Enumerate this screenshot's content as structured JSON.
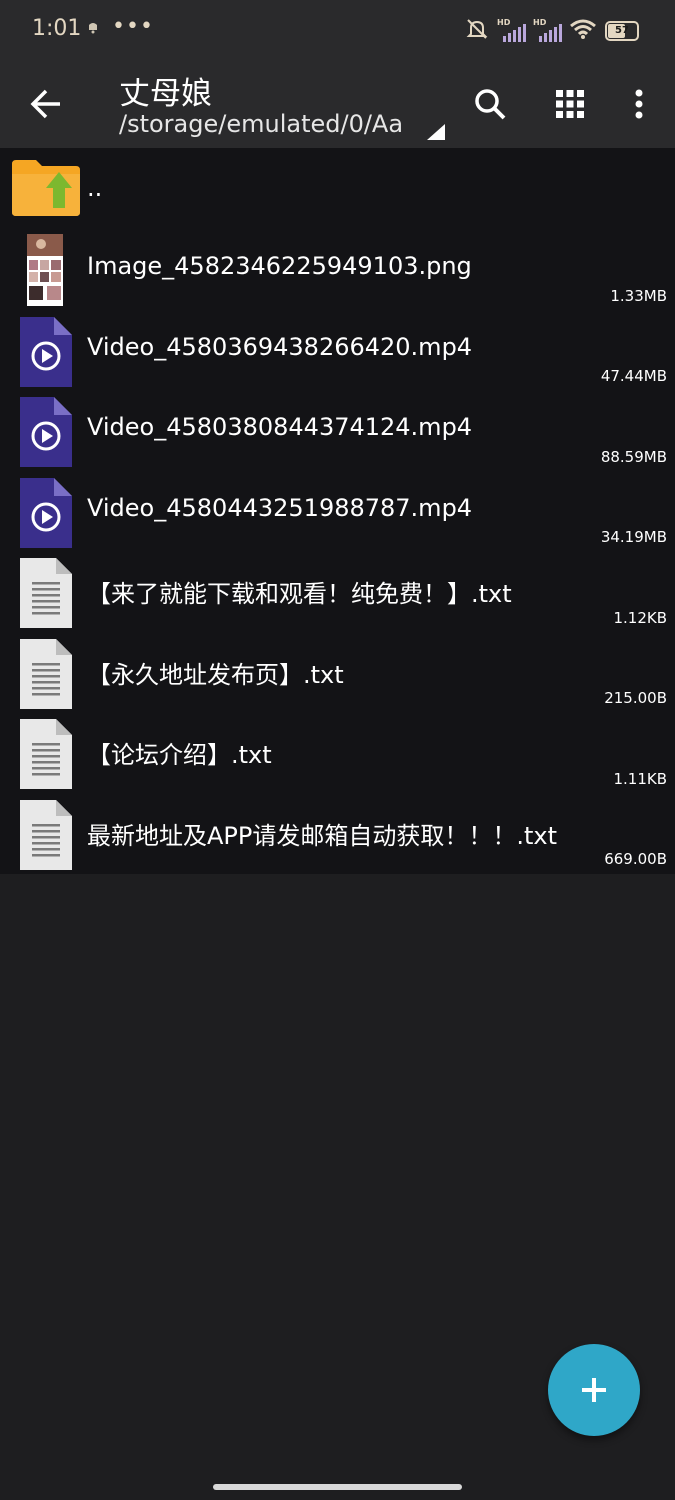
{
  "status_bar": {
    "time": "1:01",
    "notification_icon": "app-notification-icon",
    "more": "•••",
    "signal1_label": "HD",
    "signal2_label": "HD",
    "battery": "57"
  },
  "app_bar": {
    "title": "丈母娘",
    "path": "/storage/emulated/0/Aa",
    "icons": [
      "back-arrow-icon",
      "search-icon",
      "grid-view-icon",
      "more-vert-icon"
    ]
  },
  "files": [
    {
      "name": "..",
      "size": "",
      "type": "parent"
    },
    {
      "name": "Image_4582346225949103.png",
      "size": "1.33MB",
      "type": "image"
    },
    {
      "name": "Video_4580369438266420.mp4",
      "size": "47.44MB",
      "type": "video"
    },
    {
      "name": "Video_4580380844374124.mp4",
      "size": "88.59MB",
      "type": "video"
    },
    {
      "name": "Video_4580443251988787.mp4",
      "size": "34.19MB",
      "type": "video"
    },
    {
      "name": "【来了就能下载和观看！纯免费！】.txt",
      "size": "1.12KB",
      "type": "text"
    },
    {
      "name": "【永久地址发布页】.txt",
      "size": "215.00B",
      "type": "text"
    },
    {
      "name": "【论坛介绍】.txt",
      "size": "1.11KB",
      "type": "text"
    },
    {
      "name": "最新地址及APP请发邮箱自动获取！！！.txt",
      "size": "669.00B",
      "type": "text"
    }
  ],
  "fab": {
    "icon": "plus-icon"
  },
  "colors": {
    "background": "#1e1e20",
    "list_background": "#131316",
    "bar": "#2a2a2c",
    "accent": "#2fa7c8",
    "video_icon": "#3a2f8c",
    "folder": "#f5a623"
  }
}
